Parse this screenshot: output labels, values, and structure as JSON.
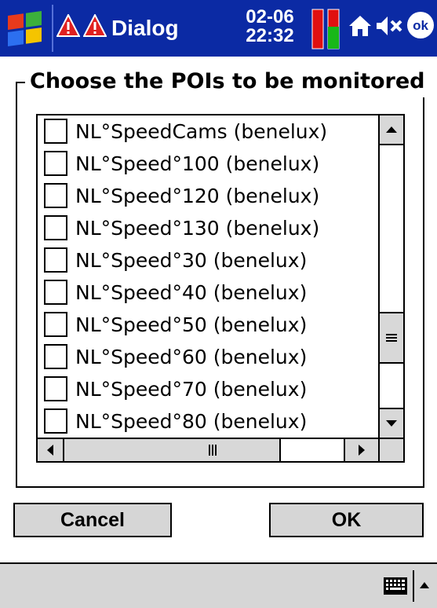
{
  "title_bar": {
    "title": "Dialog",
    "date": "02-06",
    "time": "22:32"
  },
  "group": {
    "legend": "Choose the POIs to be monitored"
  },
  "poi_list": {
    "items": [
      {
        "label": "NL°SpeedCams (benelux)",
        "checked": false
      },
      {
        "label": "NL°Speed°100 (benelux)",
        "checked": false
      },
      {
        "label": "NL°Speed°120 (benelux)",
        "checked": false
      },
      {
        "label": "NL°Speed°130 (benelux)",
        "checked": false
      },
      {
        "label": "NL°Speed°30 (benelux)",
        "checked": false
      },
      {
        "label": "NL°Speed°40 (benelux)",
        "checked": false
      },
      {
        "label": "NL°Speed°50 (benelux)",
        "checked": false
      },
      {
        "label": "NL°Speed°60 (benelux)",
        "checked": false
      },
      {
        "label": "NL°Speed°70 (benelux)",
        "checked": false
      },
      {
        "label": "NL°Speed°80 (benelux)",
        "checked": false
      }
    ]
  },
  "buttons": {
    "cancel": "Cancel",
    "ok": "OK"
  },
  "icons": {
    "start": "windows-start-icon",
    "warning": "warning-icon",
    "signal": "signal-strength-icon",
    "home": "home-icon",
    "volume": "volume-muted-icon",
    "ok": "ok-close-icon",
    "keyboard": "keyboard-icon",
    "sip": "chevron-up-icon"
  },
  "colors": {
    "titlebar": "#0b2aa4",
    "button_face": "#d6d6d6",
    "warning_red": "#e02020",
    "signal_red": "#e01010",
    "signal_green": "#18b818"
  }
}
